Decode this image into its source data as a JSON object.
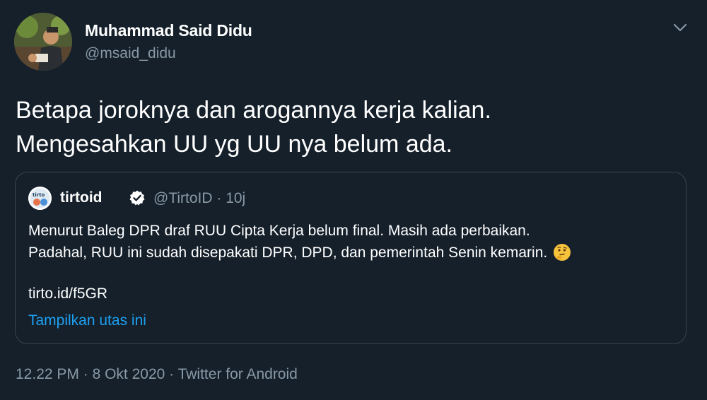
{
  "author": {
    "name": "Muhammad Said Didu",
    "handle": "@msaid_didu"
  },
  "tweet": {
    "text_line1": "Betapa joroknya dan arogannya kerja kalian.",
    "text_line2": "Mengesahkan UU yg UU nya belum ada."
  },
  "quoted": {
    "name": "tirtoid",
    "handle_time": "@TirtoID · 10j",
    "text_line1": "Menurut Baleg DPR draf RUU Cipta Kerja belum final. Masih ada perbaikan.",
    "text_line2": "Padahal, RUU ini sudah disepakati DPR, DPD, dan pemerintah Senin kemarin.",
    "link": "tirto.id/f5GR",
    "show_thread": "Tampilkan utas ini"
  },
  "meta": {
    "time": "12.22 PM",
    "date": "8 Okt 2020",
    "source": "Twitter for Android",
    "separator": " · "
  },
  "icons": {
    "caret": "chevron-down-icon",
    "verified": "verified-badge-icon",
    "emoji": "thinking-face-emoji"
  },
  "colors": {
    "background": "#15202b",
    "secondary_text": "#8899a6",
    "accent": "#1da1f2",
    "border": "#38444d"
  }
}
